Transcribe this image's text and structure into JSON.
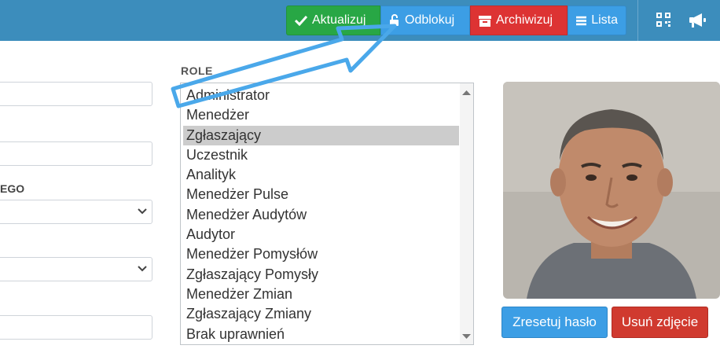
{
  "toolbar": {
    "update_label": "Aktualizuj",
    "unlock_label": "Odblokuj",
    "archive_label": "Archiwizuj",
    "list_label": "Lista"
  },
  "colors": {
    "topbar": "#3c8dbc",
    "update": "#28a745",
    "unlock": "#3c9ee5",
    "archive": "#dd3333",
    "delete": "#d03a2f",
    "annotation_arrow": "#4aa8ea"
  },
  "icons": [
    "check-icon",
    "unlock-icon",
    "archive-box-icon",
    "list-icon",
    "qr-code-icon",
    "megaphone-icon",
    "chevron-down-icon"
  ],
  "form": {
    "partial_label": "EGO"
  },
  "roles": {
    "label": "ROLE",
    "items": [
      "Administrator",
      "Menedżer",
      "Zgłaszający",
      "Uczestnik",
      "Analityk",
      "Menedżer Pulse",
      "Menedżer Audytów",
      "Audytor",
      "Menedżer Pomysłów",
      "Zgłaszający Pomysły",
      "Menedżer Zmian",
      "Zgłaszający Zmiany",
      "Brak uprawnień"
    ],
    "selected": "Zgłaszający"
  },
  "photo": {
    "reset_password_label": "Zresetuj hasło",
    "delete_photo_label": "Usuń zdjęcie"
  }
}
